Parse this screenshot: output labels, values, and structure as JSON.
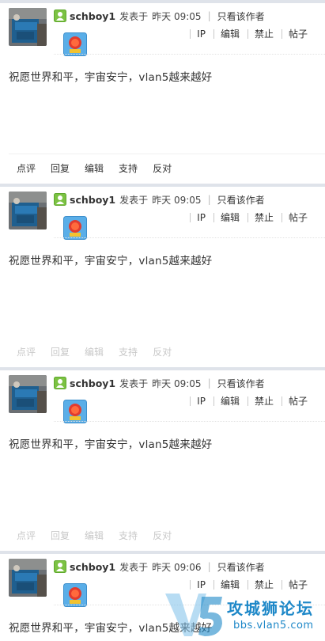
{
  "posts": [
    {
      "author": "schboy1",
      "posted_label": "发表于",
      "posted_time": "昨天 09:05",
      "only_author": "只看该作者",
      "ops": [
        "IP",
        "编辑",
        "禁止",
        "帖子"
      ],
      "content": "祝愿世界和平，宇宙安宁，vlan5越来越好",
      "actions": [
        "点评",
        "回复",
        "编辑",
        "支持",
        "反对"
      ],
      "actions_dimmed": false
    },
    {
      "author": "schboy1",
      "posted_label": "发表于",
      "posted_time": "昨天 09:05",
      "only_author": "只看该作者",
      "ops": [
        "IP",
        "编辑",
        "禁止",
        "帖子"
      ],
      "content": "祝愿世界和平，宇宙安宁，vlan5越来越好",
      "actions": [
        "点评",
        "回复",
        "编辑",
        "支持",
        "反对"
      ],
      "actions_dimmed": true
    },
    {
      "author": "schboy1",
      "posted_label": "发表于",
      "posted_time": "昨天 09:05",
      "only_author": "只看该作者",
      "ops": [
        "IP",
        "编辑",
        "禁止",
        "帖子"
      ],
      "content": "祝愿世界和平，宇宙安宁，vlan5越来越好",
      "actions": [
        "点评",
        "回复",
        "编辑",
        "支持",
        "反对"
      ],
      "actions_dimmed": true
    },
    {
      "author": "schboy1",
      "posted_label": "发表于",
      "posted_time": "昨天 09:06",
      "only_author": "只看该作者",
      "ops": [
        "IP",
        "编辑",
        "禁止",
        "帖子"
      ],
      "content": "祝愿世界和平，宇宙安宁，vlan5越来越好"
    }
  ],
  "icons": {
    "online": "user-online-icon",
    "badge": "medal-badge-icon"
  },
  "watermark": {
    "title": "攻城狮论坛",
    "subtitle": "bbs.vlan5.com"
  },
  "colors": {
    "divider": "#dfe3ea",
    "online_green": "#7cc243",
    "badge_blue": "#5aaee8",
    "watermark_blue": "#1e88c8"
  }
}
